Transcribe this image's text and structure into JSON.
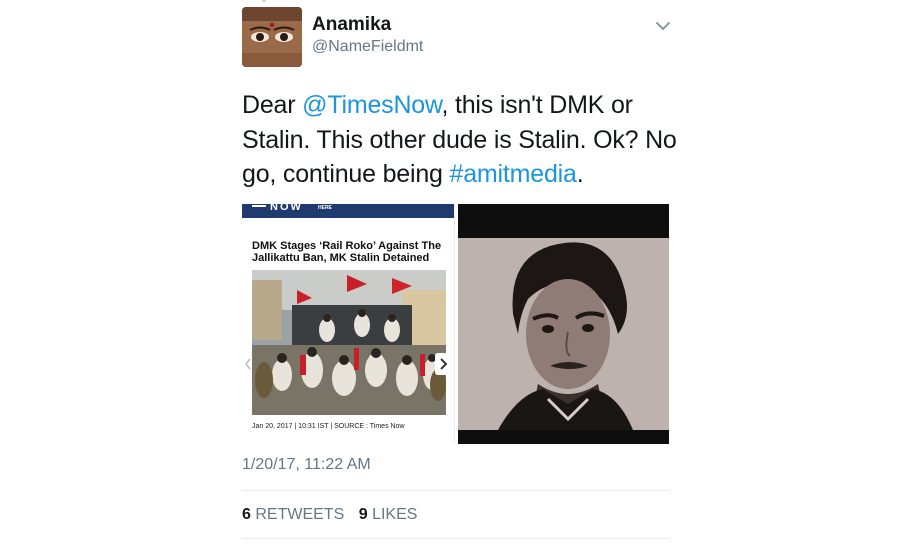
{
  "tweet": {
    "author_name": "Anamika",
    "author_handle": "@NameFieldmt",
    "text_parts": {
      "p1": "Dear ",
      "mention": "@TimesNow",
      "p2": ", this isn't DMK or Stalin. This other dude is Stalin. Ok? No go, continue being ",
      "hashtag": "#amitmedia",
      "p3": "."
    },
    "timestamp": "1/20/17, 11:22 AM",
    "retweets_count": "6",
    "retweets_label": "RETWEETS",
    "likes_count": "9",
    "likes_label": "LIKES"
  },
  "media": {
    "left_card": {
      "brand": "NOW",
      "brand_sub": "HERE",
      "headline": "DMK Stages ‘Rail Roko’ Against The Jallikattu Ban, MK Stalin Detained",
      "meta": "Jan 20, 2017 | 10:31 IST | SOURCE : Times Now"
    }
  },
  "colors": {
    "link": "#1b95e0",
    "secondary_text": "#657786",
    "primary_text": "#14171a",
    "times_now_bar": "#1f3a6e"
  },
  "icons": {
    "caret": "chevron-down-icon",
    "next": "chevron-right-icon",
    "prev": "chevron-left-icon"
  }
}
